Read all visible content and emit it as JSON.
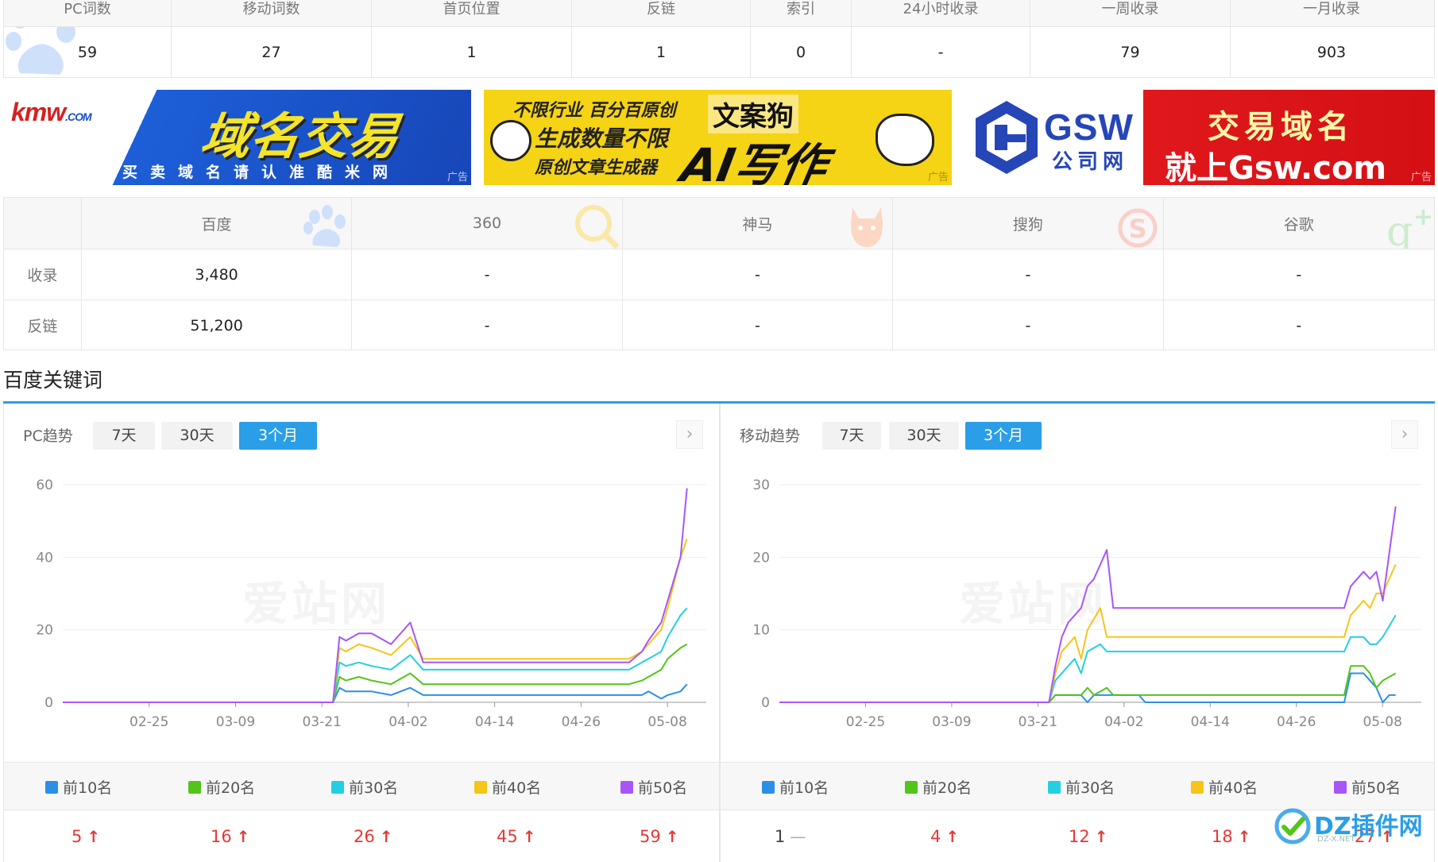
{
  "top_stats": {
    "headers": [
      "PC词数",
      "移动词数",
      "首页位置",
      "反链",
      "索引",
      "24小时收录",
      "一周收录",
      "一月收录"
    ],
    "values": [
      "59",
      "27",
      "1",
      "1",
      "0",
      "-",
      "79",
      "903"
    ]
  },
  "ads": {
    "ad1": {
      "brand": "kmw",
      "brand_small": ".COM",
      "headline": "域名交易",
      "subline": "买卖域名请认准酷米网",
      "tag": "广告"
    },
    "ad2": {
      "line1": "不限行业 百分百原创",
      "line2": "生成数量不限",
      "line3": "原创文章生成器",
      "brand": "文案狗",
      "headline": "AI写作",
      "tag": "广告"
    },
    "ad3": {
      "brand": "GSW",
      "brand_sub": "公司网",
      "line1": "交易域名",
      "line2": "就上Gsw.com",
      "tag": "广告"
    }
  },
  "engines": {
    "headers": [
      "百度",
      "360",
      "神马",
      "搜狗",
      "谷歌"
    ],
    "rows": [
      {
        "label": "收录",
        "values": [
          "3,480",
          "-",
          "-",
          "-",
          "-"
        ]
      },
      {
        "label": "反链",
        "values": [
          "51,200",
          "-",
          "-",
          "-",
          "-"
        ]
      }
    ]
  },
  "section": {
    "title": "百度关键词"
  },
  "colors": {
    "top10": "#2b8fe6",
    "top20": "#52c41a",
    "top30": "#22d0e0",
    "top40": "#f5c518",
    "top50": "#a855f7",
    "accent": "#2a9ee6",
    "up": "#e53935"
  },
  "pc": {
    "title": "PC趋势",
    "ranges": [
      "7天",
      "30天",
      "3个月"
    ],
    "active_range": "3个月",
    "watermark": "爱站网",
    "next_icon": "chevron-right-icon",
    "legend": [
      "前10名",
      "前20名",
      "前30名",
      "前40名",
      "前50名"
    ],
    "stats": [
      {
        "value": "5",
        "trend": "up"
      },
      {
        "value": "16",
        "trend": "up"
      },
      {
        "value": "26",
        "trend": "up"
      },
      {
        "value": "45",
        "trend": "up"
      },
      {
        "value": "59",
        "trend": "up"
      }
    ]
  },
  "mobile": {
    "title": "移动趋势",
    "ranges": [
      "7天",
      "30天",
      "3个月"
    ],
    "active_range": "3个月",
    "watermark": "爱站网",
    "next_icon": "chevron-right-icon",
    "legend": [
      "前10名",
      "前20名",
      "前30名",
      "前40名",
      "前50名"
    ],
    "stats": [
      {
        "value": "1",
        "trend": "flat"
      },
      {
        "value": "4",
        "trend": "up"
      },
      {
        "value": "12",
        "trend": "up"
      },
      {
        "value": "18",
        "trend": "up"
      },
      {
        "value": "27",
        "trend": "up"
      }
    ]
  },
  "chart_data": [
    {
      "type": "line",
      "title": "",
      "xlabel": "",
      "ylabel": "",
      "ylim": [
        0,
        60
      ],
      "yticks": [
        0,
        20,
        40,
        60
      ],
      "xticks": [
        "02-25",
        "03-09",
        "03-21",
        "04-02",
        "04-14",
        "04-26",
        "05-08"
      ],
      "grid": true,
      "legend": "bottom",
      "series": [
        {
          "name": "前10名",
          "points": [
            [
              0,
              0
            ],
            [
              42,
              0
            ],
            [
              43,
              4
            ],
            [
              44,
              3
            ],
            [
              48,
              3
            ],
            [
              51,
              2
            ],
            [
              54,
              4
            ],
            [
              56,
              2
            ],
            [
              88,
              2
            ],
            [
              90,
              2
            ],
            [
              91,
              3
            ],
            [
              93,
              1
            ],
            [
              94,
              2
            ],
            [
              96,
              3
            ],
            [
              97,
              5
            ]
          ]
        },
        {
          "name": "前20名",
          "points": [
            [
              0,
              0
            ],
            [
              42,
              0
            ],
            [
              43,
              7
            ],
            [
              44,
              6
            ],
            [
              46,
              7
            ],
            [
              48,
              6
            ],
            [
              51,
              5
            ],
            [
              54,
              8
            ],
            [
              56,
              5
            ],
            [
              88,
              5
            ],
            [
              90,
              6
            ],
            [
              91,
              7
            ],
            [
              93,
              9
            ],
            [
              94,
              12
            ],
            [
              96,
              15
            ],
            [
              97,
              16
            ]
          ]
        },
        {
          "name": "前30名",
          "points": [
            [
              0,
              0
            ],
            [
              42,
              0
            ],
            [
              43,
              11
            ],
            [
              44,
              10
            ],
            [
              46,
              11
            ],
            [
              48,
              10
            ],
            [
              51,
              9
            ],
            [
              54,
              13
            ],
            [
              56,
              9
            ],
            [
              88,
              9
            ],
            [
              90,
              11
            ],
            [
              91,
              12
            ],
            [
              93,
              14
            ],
            [
              94,
              18
            ],
            [
              96,
              24
            ],
            [
              97,
              26
            ]
          ]
        },
        {
          "name": "前40名",
          "points": [
            [
              0,
              0
            ],
            [
              42,
              0
            ],
            [
              43,
              15
            ],
            [
              44,
              14
            ],
            [
              46,
              16
            ],
            [
              48,
              15
            ],
            [
              51,
              13
            ],
            [
              54,
              18
            ],
            [
              56,
              12
            ],
            [
              88,
              12
            ],
            [
              90,
              14
            ],
            [
              91,
              16
            ],
            [
              93,
              20
            ],
            [
              94,
              26
            ],
            [
              96,
              40
            ],
            [
              97,
              45
            ]
          ]
        },
        {
          "name": "前50名",
          "points": [
            [
              0,
              0
            ],
            [
              42,
              0
            ],
            [
              43,
              18
            ],
            [
              44,
              17
            ],
            [
              46,
              19
            ],
            [
              48,
              19
            ],
            [
              51,
              16
            ],
            [
              54,
              22
            ],
            [
              56,
              11
            ],
            [
              88,
              11
            ],
            [
              90,
              14
            ],
            [
              91,
              17
            ],
            [
              93,
              22
            ],
            [
              94,
              28
            ],
            [
              96,
              40
            ],
            [
              97,
              59
            ]
          ]
        }
      ]
    },
    {
      "type": "line",
      "title": "",
      "xlabel": "",
      "ylabel": "",
      "ylim": [
        0,
        30
      ],
      "yticks": [
        0,
        10,
        20,
        30
      ],
      "xticks": [
        "02-25",
        "03-09",
        "03-21",
        "04-02",
        "04-14",
        "04-26",
        "05-08"
      ],
      "grid": true,
      "legend": "bottom",
      "series": [
        {
          "name": "前10名",
          "points": [
            [
              0,
              0
            ],
            [
              42,
              0
            ],
            [
              43,
              1
            ],
            [
              47,
              1
            ],
            [
              48,
              0
            ],
            [
              49,
              1
            ],
            [
              56,
              1
            ],
            [
              57,
              0
            ],
            [
              88,
              0
            ],
            [
              89,
              4
            ],
            [
              91,
              4
            ],
            [
              92,
              3
            ],
            [
              93,
              2
            ],
            [
              94,
              0
            ],
            [
              95,
              1
            ],
            [
              96,
              1
            ]
          ]
        },
        {
          "name": "前20名",
          "points": [
            [
              0,
              0
            ],
            [
              42,
              0
            ],
            [
              43,
              1
            ],
            [
              47,
              1
            ],
            [
              48,
              2
            ],
            [
              49,
              1
            ],
            [
              51,
              2
            ],
            [
              52,
              1
            ],
            [
              88,
              1
            ],
            [
              89,
              5
            ],
            [
              91,
              5
            ],
            [
              92,
              4
            ],
            [
              93,
              2
            ],
            [
              94,
              3
            ],
            [
              96,
              4
            ]
          ]
        },
        {
          "name": "前30名",
          "points": [
            [
              0,
              0
            ],
            [
              42,
              0
            ],
            [
              43,
              3
            ],
            [
              45,
              5
            ],
            [
              46,
              6
            ],
            [
              47,
              4
            ],
            [
              48,
              7
            ],
            [
              50,
              8
            ],
            [
              51,
              7
            ],
            [
              88,
              7
            ],
            [
              89,
              9
            ],
            [
              91,
              9
            ],
            [
              92,
              8
            ],
            [
              93,
              8
            ],
            [
              94,
              9
            ],
            [
              96,
              12
            ]
          ]
        },
        {
          "name": "前40名",
          "points": [
            [
              0,
              0
            ],
            [
              42,
              0
            ],
            [
              43,
              4
            ],
            [
              44,
              7
            ],
            [
              46,
              9
            ],
            [
              47,
              6
            ],
            [
              48,
              10
            ],
            [
              50,
              13
            ],
            [
              51,
              9
            ],
            [
              88,
              9
            ],
            [
              89,
              12
            ],
            [
              91,
              14
            ],
            [
              92,
              13
            ],
            [
              93,
              15
            ],
            [
              94,
              15
            ],
            [
              96,
              19
            ]
          ]
        },
        {
          "name": "前50名",
          "points": [
            [
              0,
              0
            ],
            [
              42,
              0
            ],
            [
              43,
              5
            ],
            [
              44,
              9
            ],
            [
              45,
              11
            ],
            [
              46,
              12
            ],
            [
              47,
              13
            ],
            [
              48,
              16
            ],
            [
              49,
              17
            ],
            [
              50,
              19
            ],
            [
              51,
              21
            ],
            [
              52,
              13
            ],
            [
              88,
              13
            ],
            [
              89,
              16
            ],
            [
              91,
              18
            ],
            [
              92,
              17
            ],
            [
              93,
              18
            ],
            [
              94,
              14
            ],
            [
              96,
              27
            ]
          ]
        }
      ]
    }
  ]
}
